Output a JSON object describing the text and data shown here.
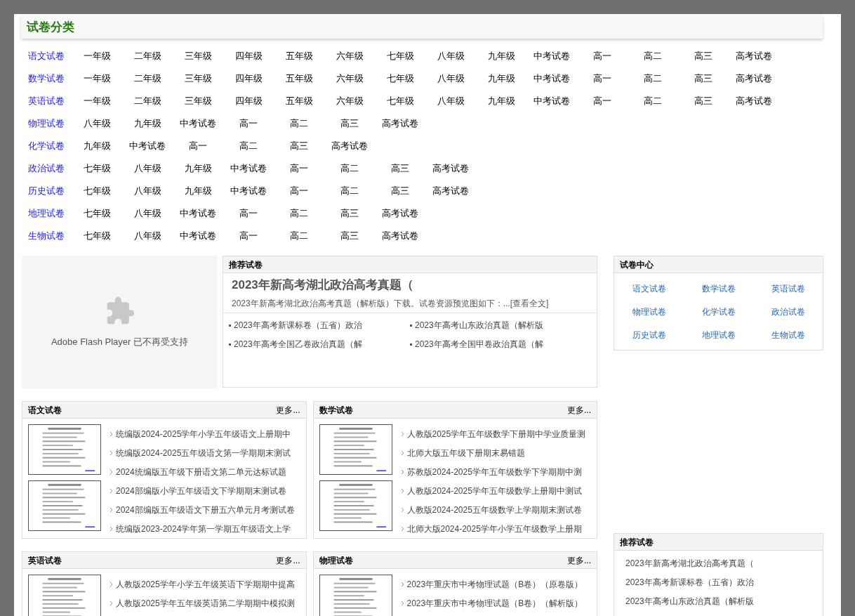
{
  "header": {
    "title": "试卷分类"
  },
  "categories": [
    {
      "subject": "语文试卷",
      "grades": [
        "一年级",
        "二年级",
        "三年级",
        "四年级",
        "五年级",
        "六年级",
        "七年级",
        "八年级",
        "九年级",
        "中考试卷",
        "高一",
        "高二",
        "高三",
        "高考试卷"
      ]
    },
    {
      "subject": "数学试卷",
      "grades": [
        "一年级",
        "二年级",
        "三年级",
        "四年级",
        "五年级",
        "六年级",
        "七年级",
        "八年级",
        "九年级",
        "中考试卷",
        "高一",
        "高二",
        "高三",
        "高考试卷"
      ]
    },
    {
      "subject": "英语试卷",
      "grades": [
        "一年级",
        "二年级",
        "三年级",
        "四年级",
        "五年级",
        "六年级",
        "七年级",
        "八年级",
        "九年级",
        "中考试卷",
        "高一",
        "高二",
        "高三",
        "高考试卷"
      ]
    },
    {
      "subject": "物理试卷",
      "grades": [
        "八年级",
        "九年级",
        "中考试卷",
        "高一",
        "高二",
        "高三",
        "高考试卷"
      ]
    },
    {
      "subject": "化学试卷",
      "grades": [
        "九年级",
        "中考试卷",
        "高一",
        "高二",
        "高三",
        "高考试卷"
      ]
    },
    {
      "subject": "政治试卷",
      "grades": [
        "七年级",
        "八年级",
        "九年级",
        "中考试卷",
        "高一",
        "高二",
        "高三",
        "高考试卷"
      ]
    },
    {
      "subject": "历史试卷",
      "grades": [
        "七年级",
        "八年级",
        "九年级",
        "中考试卷",
        "高一",
        "高二",
        "高三",
        "高考试卷"
      ]
    },
    {
      "subject": "地理试卷",
      "grades": [
        "七年级",
        "八年级",
        "中考试卷",
        "高一",
        "高二",
        "高三",
        "高考试卷"
      ]
    },
    {
      "subject": "生物试卷",
      "grades": [
        "七年级",
        "八年级",
        "中考试卷",
        "高一",
        "高二",
        "高三",
        "高考试卷"
      ]
    }
  ],
  "flash": {
    "message": "Adobe Flash Player 已不再受支持"
  },
  "featured": {
    "title": "推荐试卷",
    "headline": "2023年新高考湖北政治高考真题（",
    "summary": "2023年新高考湖北政治高考真题（解析版）下载。试卷资源预览图如下：...",
    "more": "[查看全文]",
    "items": [
      "2023年高考新课标卷（五省）政治",
      "2023年高考山东政治真题（解析版",
      "2023年高考全国乙卷政治真题（解",
      "2023年高考全国甲卷政治真题（解"
    ]
  },
  "center": {
    "title": "试卷中心",
    "links": [
      "语文试卷",
      "数学试卷",
      "英语试卷",
      "物理试卷",
      "化学试卷",
      "政治试卷",
      "历史试卷",
      "地理试卷",
      "生物试卷"
    ]
  },
  "sections": [
    {
      "title": "语文试卷",
      "more": "更多...",
      "images": [
        {
          "kind": "picture"
        },
        {
          "kind": "picture"
        }
      ],
      "items": [
        "统编版2024-2025学年小学五年级语文上册期中",
        "统编版2024-2025五年级语文第一学期期末测试",
        "2024统编版五年级下册语文第二单元达标试题",
        "2024部编版小学五年级语文下学期期末测试卷",
        "2024部编版五年级语文下册五六单元月考测试卷",
        "统编版2023-2024学年第一学期五年级语文上学"
      ]
    },
    {
      "title": "数学试卷",
      "more": "更多...",
      "images": [
        {
          "kind": "picture"
        },
        {
          "kind": "picture"
        }
      ],
      "items": [
        "人教版2025学年五年级数学下册期中学业质量测",
        "北师大版五年级下册期末易错题",
        "苏教版2024-2025学年五年级数学下学期期中测",
        "人教版2024-2025学年五年级数学上册期中测试",
        "人教版2024-2025五年级数学上学期期末测试卷",
        "北师大版2024-2025学年小学五年级数学上册期"
      ]
    },
    {
      "title": "英语试卷",
      "more": "更多...",
      "images": [
        {
          "kind": "picture"
        }
      ],
      "items": [
        "人教版2025学年小学五年级英语下学期期中提高",
        "人教版2025学年五年级英语第二学期期中模拟测"
      ]
    },
    {
      "title": "物理试卷",
      "more": "更多...",
      "images": [
        {
          "kind": "picture"
        }
      ],
      "items": [
        "2023年重庆市中考物理试题（B卷）（原卷版）",
        "2023年重庆市中考物理试题（B卷）（解析版）"
      ]
    }
  ],
  "sidebar_recommend": {
    "title": "推荐试卷",
    "items": [
      "2023年新高考湖北政治高考真题（",
      "2023年高考新课标卷（五省）政治",
      "2023年高考山东政治真题（解析版"
    ]
  }
}
